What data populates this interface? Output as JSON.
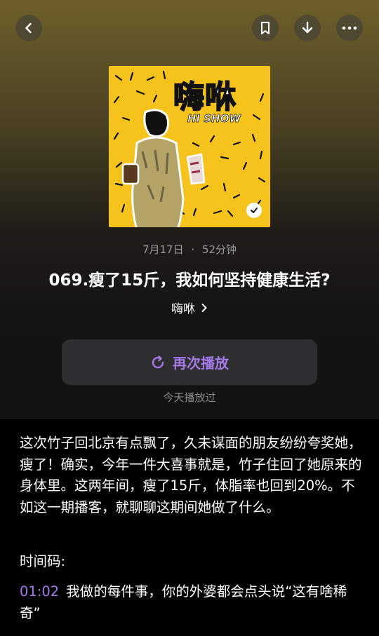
{
  "episode": {
    "date": "7月17日",
    "duration": "52分钟",
    "separator": "·",
    "title": "069.瘦了15斤，我如何坚持健康生活?",
    "author": "嗨咻"
  },
  "cover": {
    "title_cn": "嗨咻",
    "title_en": "HI SHOW",
    "background": "#f5c31c"
  },
  "actions": {
    "replay_label": "再次播放",
    "played_status": "今天播放过",
    "accent": "#a57ae8"
  },
  "icons": {
    "back": "chevron-left-icon",
    "bookmark": "bookmark-icon",
    "download": "download-icon",
    "more": "more-icon"
  },
  "description": "这次竹子回北京有点飘了，久未谋面的朋友纷纷夸奖她，瘦了！确实，今年一件大喜事就是，竹子住回了她原来的身体里。这两年间，瘦了15斤，体脂率也回到20%。不如这一期播客，就聊聊这期间她做了什么。",
  "timecodes": {
    "label": "时间码:",
    "items": [
      {
        "time": "01:02",
        "text": "我做的每件事，你的外婆都会点头说“这有啥稀奇”"
      }
    ]
  }
}
